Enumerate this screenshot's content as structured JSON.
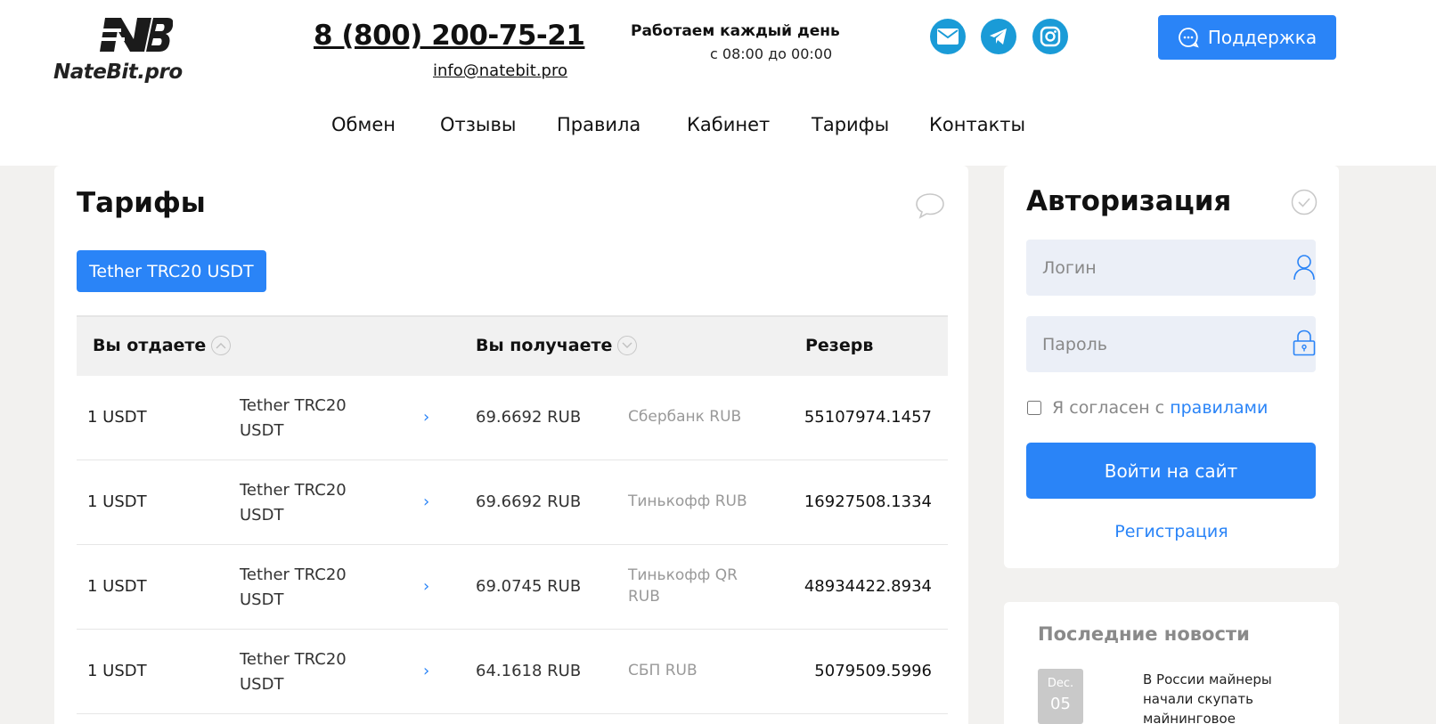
{
  "header": {
    "logo_text": "NateBit.pro",
    "phone": "8 (800) 200-75-21",
    "email": "info@natebit.pro",
    "hours_title": "Работаем каждый день",
    "hours_time": "с 08:00 до 00:00",
    "social": [
      {
        "icon": "mail-icon"
      },
      {
        "icon": "telegram-icon"
      },
      {
        "icon": "instagram-icon"
      }
    ],
    "support_label": "Поддержка"
  },
  "nav": [
    {
      "label": "Обмен"
    },
    {
      "label": "Отзывы"
    },
    {
      "label": "Правила"
    },
    {
      "label": "Кабинет"
    },
    {
      "label": "Тарифы"
    },
    {
      "label": "Контакты"
    }
  ],
  "tariffs": {
    "title": "Тарифы",
    "active_tab": "Tether TRC20 USDT",
    "columns": {
      "give": "Вы отдаете",
      "get": "Вы получаете",
      "reserve": "Резерв"
    },
    "rows": [
      {
        "give_amount": "1 USDT",
        "give_currency": "Tether TRC20 USDT",
        "get_amount": "69.6692 RUB",
        "get_currency": "Сбербанк RUB",
        "reserve": "55107974.1457"
      },
      {
        "give_amount": "1 USDT",
        "give_currency": "Tether TRC20 USDT",
        "get_amount": "69.6692 RUB",
        "get_currency": "Тинькофф RUB",
        "reserve": "16927508.1334"
      },
      {
        "give_amount": "1 USDT",
        "give_currency": "Tether TRC20 USDT",
        "get_amount": "69.0745 RUB",
        "get_currency": "Тинькофф QR RUB",
        "reserve": "48934422.8934"
      },
      {
        "give_amount": "1 USDT",
        "give_currency": "Tether TRC20 USDT",
        "get_amount": "64.1618 RUB",
        "get_currency": "СБП RUB",
        "reserve": "5079509.5996"
      }
    ]
  },
  "auth": {
    "title": "Авторизация",
    "login_placeholder": "Логин",
    "password_placeholder": "Пароль",
    "agree_text": "Я согласен с",
    "agree_link": "правилами",
    "login_button": "Войти на сайт",
    "register_link": "Регистрация"
  },
  "news": {
    "title": "Последние новости",
    "items": [
      {
        "month": "Dec.",
        "day": "05",
        "text": "В России майнеры начали скупать майнинговое"
      }
    ]
  },
  "colors": {
    "accent": "#2a84f7",
    "social": "#1a9bd7"
  }
}
